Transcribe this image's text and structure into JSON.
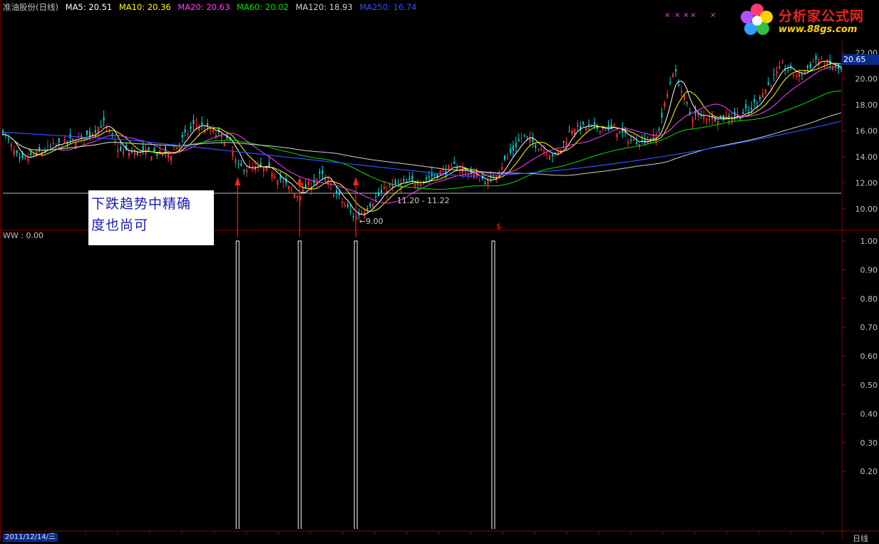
{
  "header": {
    "stock": "准油股份(日线)",
    "indicators": [
      {
        "label": "MA5: 20.51",
        "color": "#ffffff"
      },
      {
        "label": "MA10: 20.36",
        "color": "#ffff00"
      },
      {
        "label": "MA20: 20.63",
        "color": "#ff40ff"
      },
      {
        "label": "MA60: 20.02",
        "color": "#00e000"
      },
      {
        "label": "MA120: 18.93",
        "color": "#d0d0d0"
      },
      {
        "label": "MA250: 16.74",
        "color": "#3050ff"
      }
    ]
  },
  "logo": {
    "title": "分析家公式网",
    "url": "www.88gs.com"
  },
  "annotation": {
    "line1": "下跌趋势中精确",
    "line2": "度也尚可"
  },
  "current_price": "20.65",
  "lower_panel_label": "WW : 0.00",
  "date_label": "2011/12/14/三",
  "period_label": "日线",
  "colors": {
    "up": "#ff3030",
    "down": "#00d8d8",
    "ma5": "#ffffff",
    "ma10": "#ffff00",
    "ma20": "#ff40ff",
    "ma60": "#00e000",
    "ma120": "#d0d0d0",
    "ma250": "#3050ff",
    "signal": "#ff2020",
    "grid": "#8a0000"
  },
  "chart_data": [
    {
      "type": "candlestick",
      "y_ticks": [
        22.0,
        20.0,
        18.0,
        16.0,
        14.0,
        12.0,
        10.0
      ],
      "ylim": [
        8.4,
        23.0
      ],
      "support_level": 11.2,
      "annotations": [
        {
          "text": "11.20 - 11.22",
          "x": 0.47,
          "y": 11.2
        },
        {
          "text": "←9.00",
          "x": 0.425,
          "y": 9.0
        }
      ],
      "buy_signals_x": [
        0.28,
        0.354,
        0.421
      ],
      "dollar_marker": {
        "text": "$",
        "x": 0.585
      },
      "ma250_start": 15.9,
      "ma250_end": 16.74
    },
    {
      "type": "line",
      "title": "WW",
      "y_ticks": [
        1.0,
        0.9,
        0.8,
        0.7,
        0.6,
        0.5,
        0.4,
        0.3,
        0.2
      ],
      "ylim": [
        0,
        1.0
      ],
      "spikes": [
        {
          "x": 0.28,
          "value": 1.0
        },
        {
          "x": 0.354,
          "value": 1.0
        },
        {
          "x": 0.421,
          "value": 1.0
        },
        {
          "x": 0.585,
          "value": 1.0
        }
      ]
    }
  ]
}
